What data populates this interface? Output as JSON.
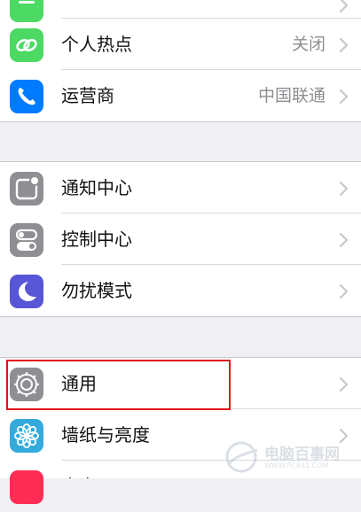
{
  "group1": {
    "hotspot": {
      "label": "个人热点",
      "value": "关闭",
      "icon": "hotspot-icon",
      "color": "#4cd964"
    },
    "carrier": {
      "label": "运营商",
      "value": "中国联通",
      "icon": "phone-icon",
      "color": "#007aff"
    }
  },
  "group2": {
    "notifications": {
      "label": "通知中心",
      "icon": "notification-center-icon",
      "color": "#8e8e93"
    },
    "control": {
      "label": "控制中心",
      "icon": "control-center-icon",
      "color": "#8e8e93"
    },
    "dnd": {
      "label": "勿扰模式",
      "icon": "moon-icon",
      "color": "#5856d6"
    }
  },
  "group3": {
    "general": {
      "label": "通用",
      "icon": "gear-icon",
      "color": "#8e8e93"
    },
    "wallpaper": {
      "label": "墙纸与亮度",
      "icon": "flower-icon",
      "color": "#34aadc"
    },
    "sounds": {
      "label": "声音",
      "icon": "speaker-icon",
      "color": "#ff2d55"
    }
  },
  "watermark": {
    "text": "电脑百事网",
    "url": "WWW.PC841.COM"
  },
  "highlight_color": "#e0101a"
}
